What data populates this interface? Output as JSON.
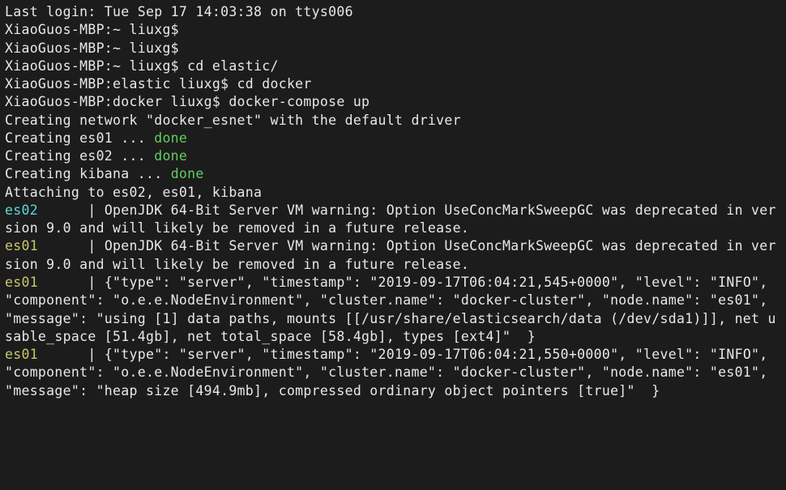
{
  "motd": "Last login: Tue Sep 17 14:03:38 on ttys006",
  "prompts": {
    "p1": "XiaoGuos-MBP:~ liuxg$",
    "p2": "XiaoGuos-MBP:~ liuxg$",
    "p3": "XiaoGuos-MBP:~ liuxg$ cd elastic/",
    "p4": "XiaoGuos-MBP:elastic liuxg$ cd docker",
    "p5": "XiaoGuos-MBP:docker liuxg$ docker-compose up"
  },
  "creating_network": "Creating network \"docker_esnet\" with the default driver",
  "creating": {
    "es01_prefix": "Creating es01 ... ",
    "es01_status": "done",
    "es02_prefix": "Creating es02 ... ",
    "es02_status": "done",
    "kibana_prefix": "Creating kibana ... ",
    "kibana_status": "done"
  },
  "attaching": "Attaching to es02, es01, kibana",
  "log1": {
    "name": "es02      ",
    "sep": "| ",
    "msg": "OpenJDK 64-Bit Server VM warning: Option UseConcMarkSweepGC was deprecated in version 9.0 and will likely be removed in a future release."
  },
  "log2": {
    "name": "es01      ",
    "sep": "| ",
    "msg": "OpenJDK 64-Bit Server VM warning: Option UseConcMarkSweepGC was deprecated in version 9.0 and will likely be removed in a future release."
  },
  "log3": {
    "name": "es01      ",
    "sep": "| ",
    "msg": "{\"type\": \"server\", \"timestamp\": \"2019-09-17T06:04:21,545+0000\", \"level\": \"INFO\", \"component\": \"o.e.e.NodeEnvironment\", \"cluster.name\": \"docker-cluster\", \"node.name\": \"es01\",  \"message\": \"using [1] data paths, mounts [[/usr/share/elasticsearch/data (/dev/sda1)]], net usable_space [51.4gb], net total_space [58.4gb], types [ext4]\"  }"
  },
  "log4": {
    "name": "es01      ",
    "sep": "| ",
    "msg": "{\"type\": \"server\", \"timestamp\": \"2019-09-17T06:04:21,550+0000\", \"level\": \"INFO\", \"component\": \"o.e.e.NodeEnvironment\", \"cluster.name\": \"docker-cluster\", \"node.name\": \"es01\",  \"message\": \"heap size [494.9mb], compressed ordinary object pointers [true]\"  }"
  }
}
